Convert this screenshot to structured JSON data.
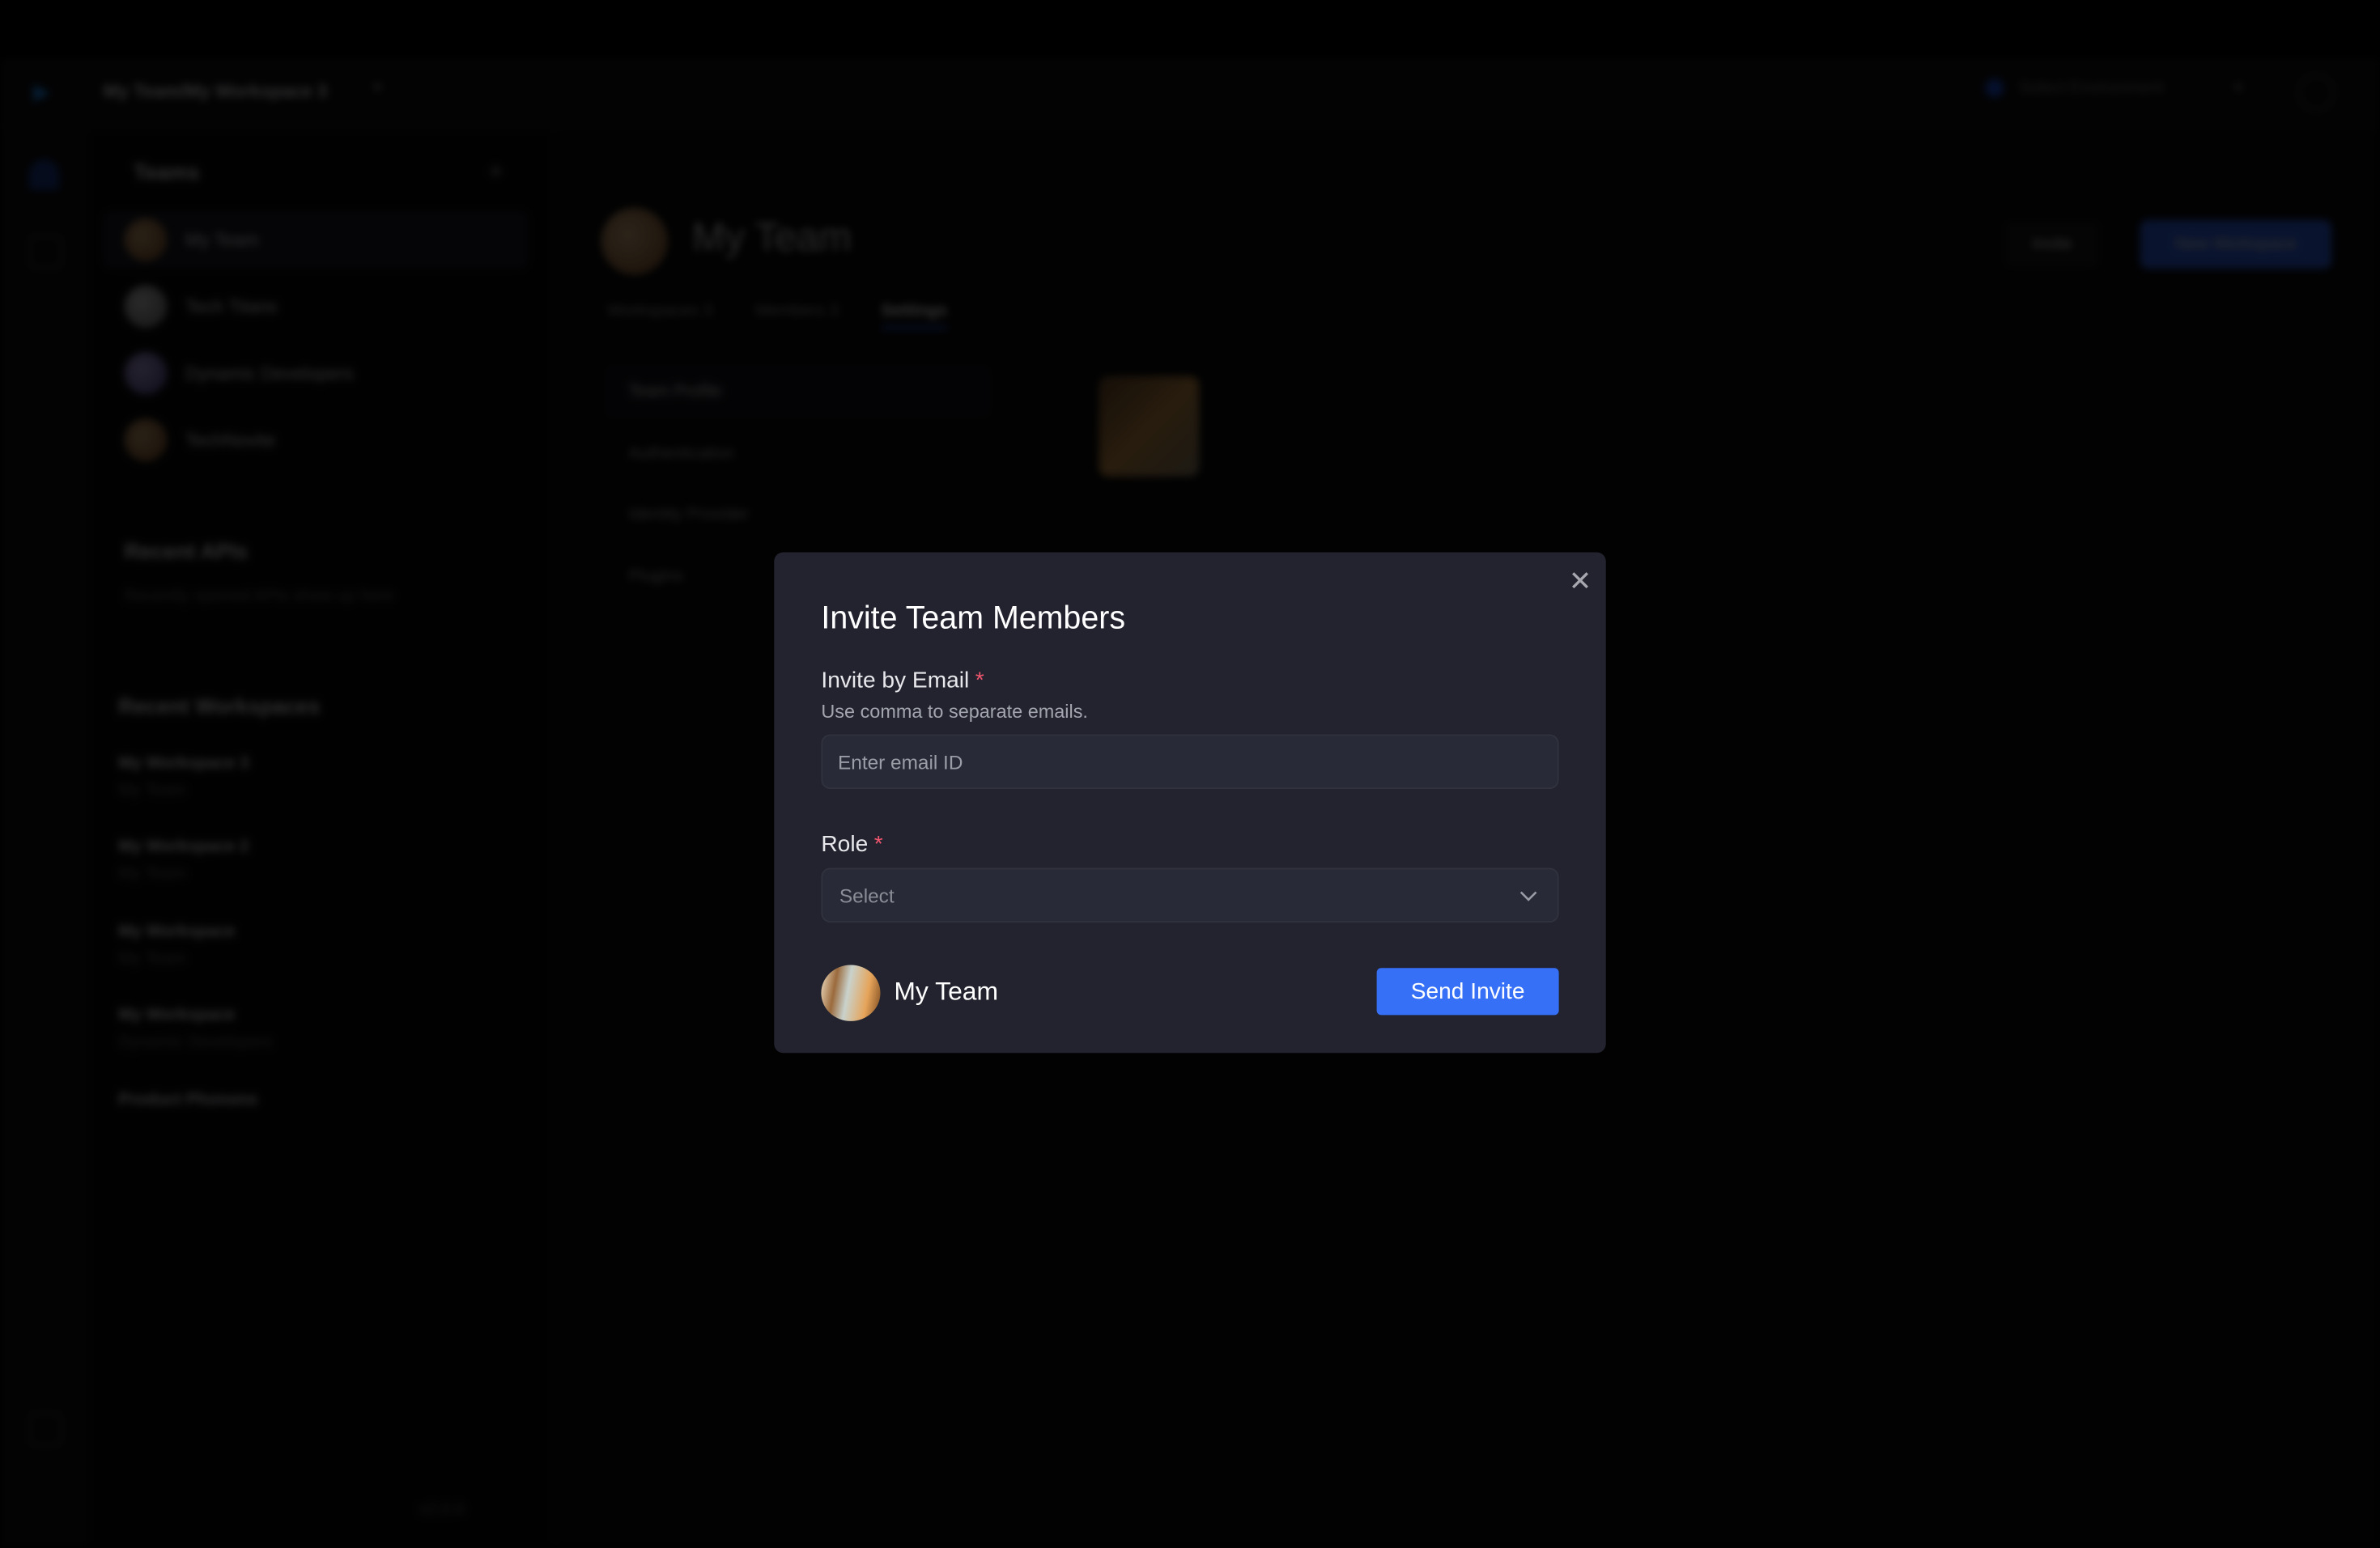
{
  "header": {
    "breadcrumb": "My Team/My Workspace 3",
    "environment": "Select Environment"
  },
  "sidebar": {
    "teams_title": "Teams",
    "teams": [
      {
        "name": "My Team"
      },
      {
        "name": "Tech Titans"
      },
      {
        "name": "Dynamic Developers"
      },
      {
        "name": "TechNovite"
      }
    ],
    "recent_apis_title": "Recent APIs",
    "recent_apis_empty": "Recently opened APIs show up here",
    "recent_workspaces_title": "Recent Workspaces",
    "workspaces": [
      {
        "name": "My Workspace 3",
        "team": "My Team"
      },
      {
        "name": "My Workspace 2",
        "team": "My Team"
      },
      {
        "name": "My Workspace",
        "team": "My Team"
      },
      {
        "name": "My Workspace",
        "team": "Dynamic Developers"
      }
    ],
    "product_section": "Product Phonons",
    "version": "v2.0.0"
  },
  "main": {
    "team_name": "My Team",
    "invite_label": "Invite",
    "new_workspace_label": "New Workspace",
    "tabs": [
      {
        "label": "Workspaces 3"
      },
      {
        "label": "Members 3"
      },
      {
        "label": "Settings"
      }
    ],
    "settings_nav": [
      {
        "label": "Team Profile"
      },
      {
        "label": "Authentication"
      },
      {
        "label": "Identity Provider"
      },
      {
        "label": "Plugins"
      }
    ]
  },
  "modal": {
    "title": "Invite Team Members",
    "email_label": "Invite by Email",
    "required_mark": "*",
    "email_help": "Use comma to separate emails.",
    "email_placeholder": "Enter email ID",
    "role_label": "Role",
    "role_placeholder": "Select",
    "team_name": "My Team",
    "send_label": "Send Invite",
    "close_icon": "close-icon",
    "accent_color": "#3670f7"
  }
}
